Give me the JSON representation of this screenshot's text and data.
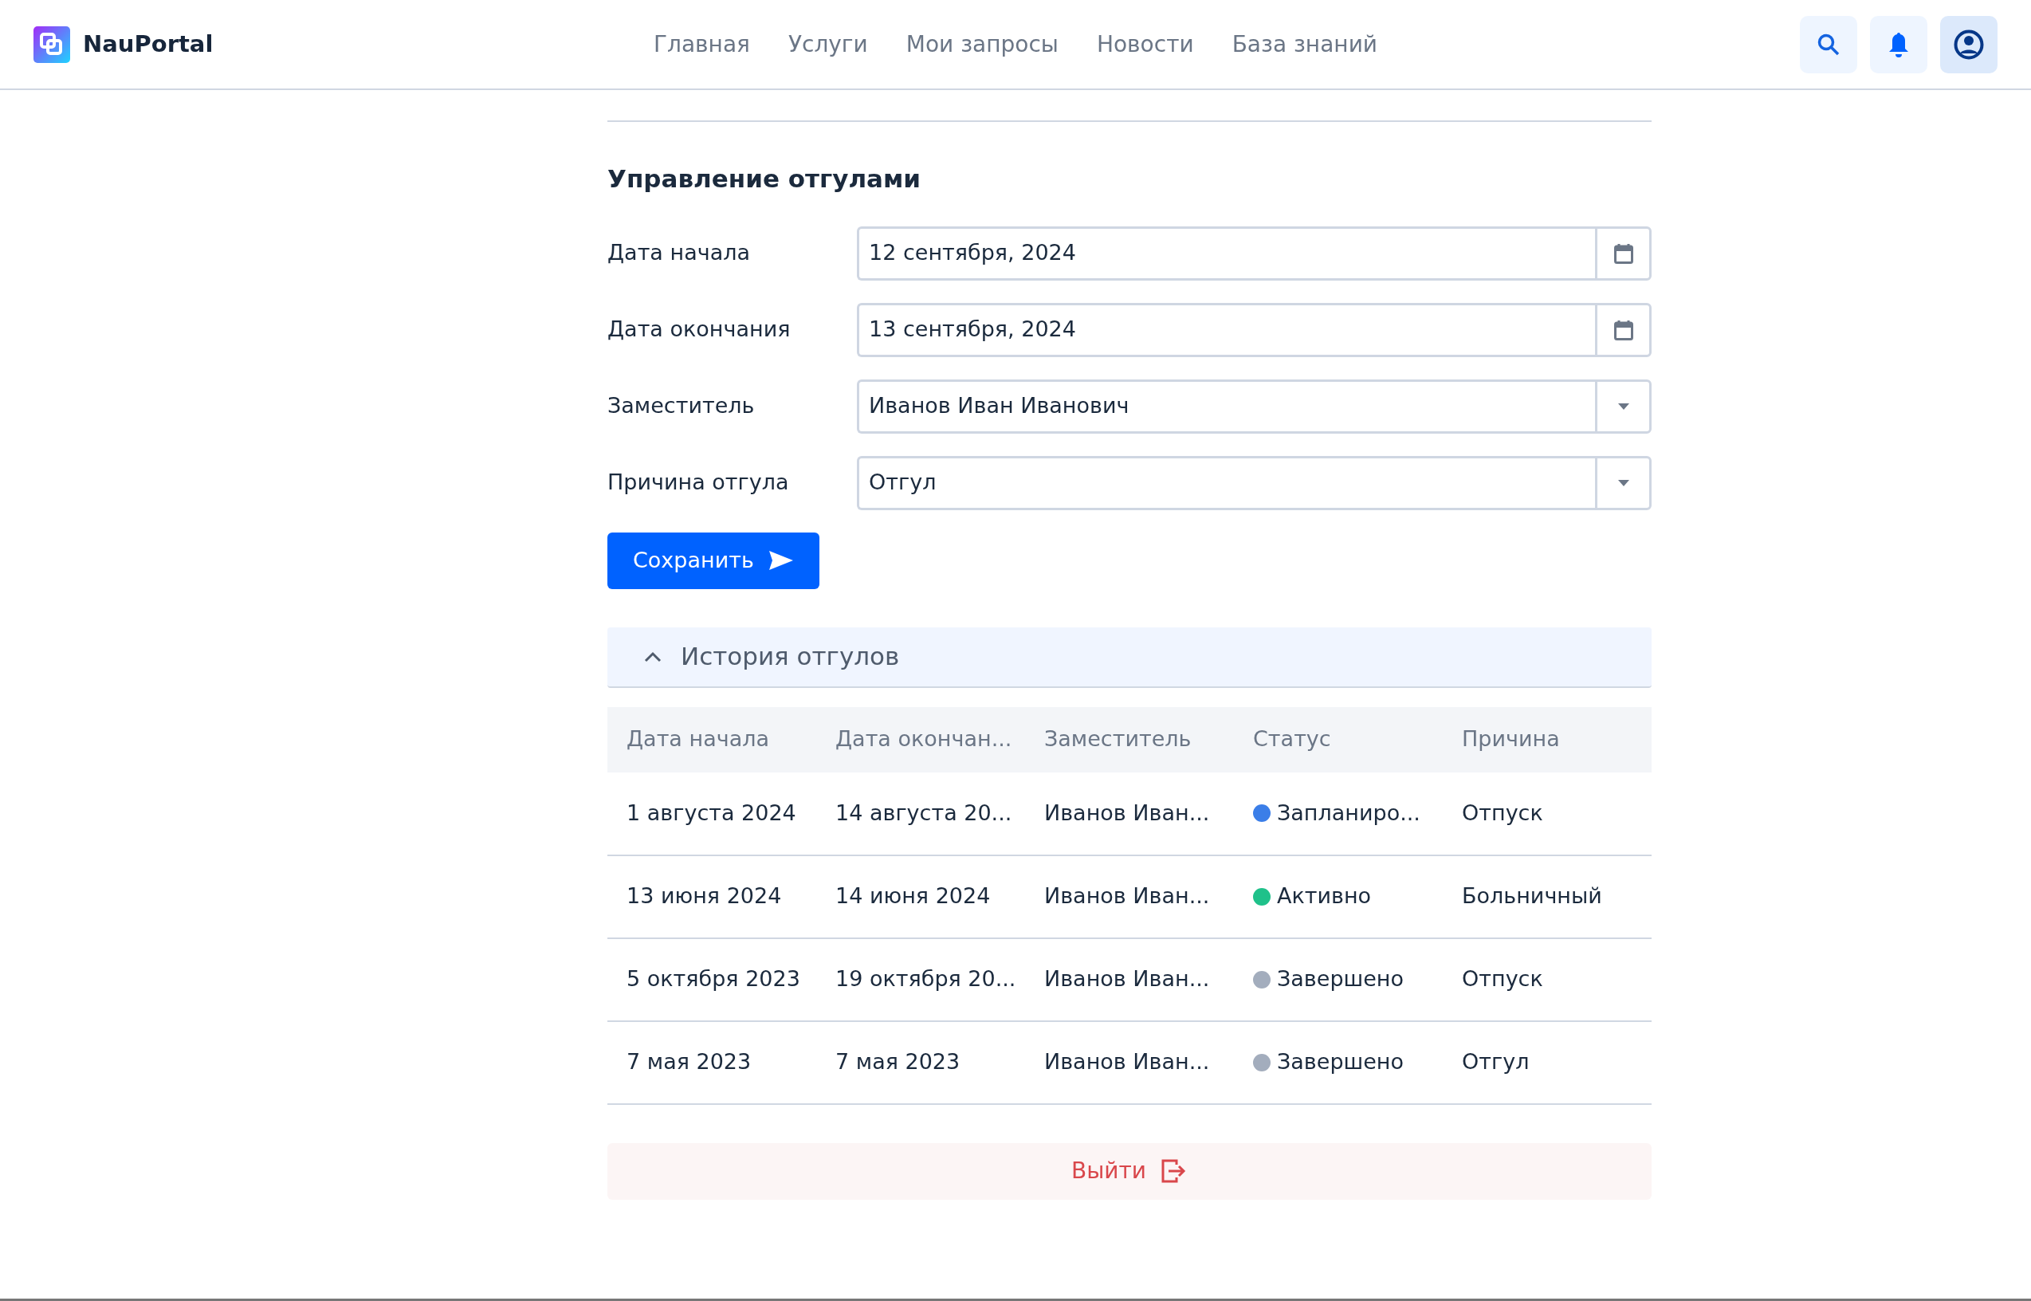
{
  "header": {
    "brand": "NauPortal",
    "nav": [
      "Главная",
      "Услуги",
      "Мои запросы",
      "Новости",
      "База знаний"
    ]
  },
  "form": {
    "title": "Управление отгулами",
    "fields": [
      {
        "kind": "date",
        "label": "Дата начала",
        "value": "12 сентября, 2024"
      },
      {
        "kind": "date",
        "label": "Дата окончания",
        "value": "13 сентября, 2024"
      },
      {
        "kind": "select",
        "label": "Заместитель",
        "value": "Иванов Иван Иванович"
      },
      {
        "kind": "select",
        "label": "Причина отгула",
        "value": "Отгул"
      }
    ],
    "submit": "Сохранить"
  },
  "history": {
    "title": "История отгулов",
    "expanded": true,
    "columns": [
      "Дата начала",
      "Дата окончан...",
      "Заместитель",
      "Статус",
      "Причина"
    ],
    "rows": [
      {
        "start": "1 августа 2024",
        "end": "14 августа 20...",
        "deputy": "Иванов Иван...",
        "status": "Запланиро...",
        "color": "#3b7ee8",
        "reason": "Отпуск"
      },
      {
        "start": "13 июня 2024",
        "end": "14 июня 2024",
        "deputy": "Иванов Иван...",
        "status": "Активно",
        "color": "#1fc18a",
        "reason": "Больничный"
      },
      {
        "start": "5 октября 2023",
        "end": "19 октября 20...",
        "deputy": "Иванов Иван...",
        "status": "Завершено",
        "color": "#a3adbd",
        "reason": "Отпуск"
      },
      {
        "start": "7 мая 2023",
        "end": "7 мая 2023",
        "deputy": "Иванов Иван...",
        "status": "Завершено",
        "color": "#a3adbd",
        "reason": "Отгул"
      }
    ]
  },
  "logout": "Выйти"
}
